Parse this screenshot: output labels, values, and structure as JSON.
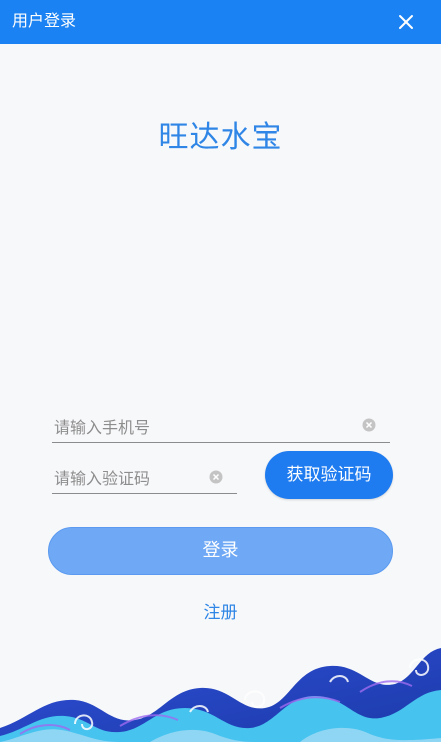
{
  "header": {
    "title": "用户登录",
    "close_icon": "close-icon"
  },
  "brand": {
    "name": "旺达水宝"
  },
  "form": {
    "phone_placeholder": "请输入手机号",
    "phone_value": "",
    "code_placeholder": "请输入验证码",
    "code_value": "",
    "clear_icon": "clear-circle-icon",
    "get_code_label": "获取验证码",
    "login_label": "登录",
    "register_label": "注册"
  },
  "colors": {
    "header_bg": "#1a82f2",
    "brand_text": "#2f86e6",
    "primary_button": "#1f7cf0",
    "login_button_disabled": "#6fa9f5",
    "background": "#f7f8fa"
  },
  "decoration": {
    "footer_art": "ocean-waves-illustration"
  }
}
